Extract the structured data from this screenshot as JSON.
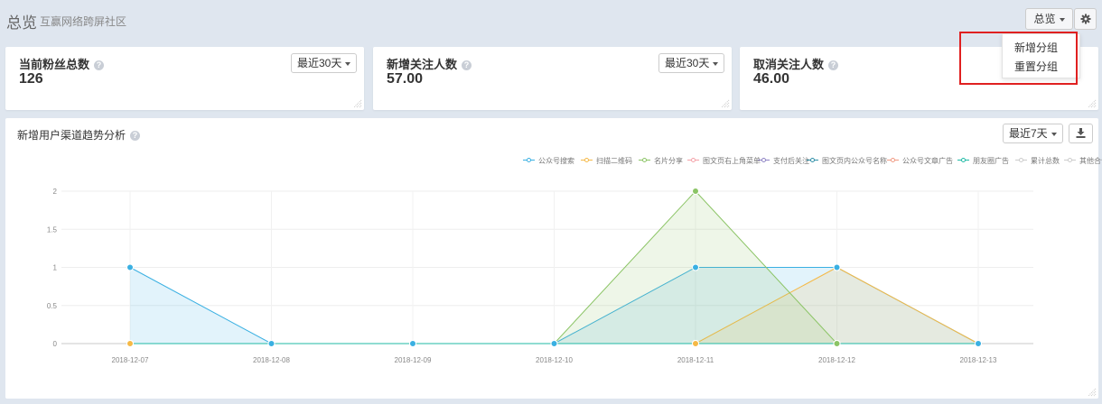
{
  "header": {
    "title": "总览",
    "subtitle": "互赢网络跨屏社区",
    "overview_label": "总览",
    "settings_icon": "gear-icon"
  },
  "menu": {
    "items": [
      "新增分组",
      "重置分组"
    ]
  },
  "cards": [
    {
      "label": "当前粉丝总数",
      "value": "126",
      "range": "最近30天"
    },
    {
      "label": "新增关注人数",
      "value": "57.00",
      "range": "最近30天"
    },
    {
      "label": "取消关注人数",
      "value": "46.00",
      "range": ""
    }
  ],
  "chart_panel": {
    "title": "新增用户渠道趋势分析",
    "range": "最近7天",
    "download_icon": "download-icon"
  },
  "chart_data": {
    "type": "area",
    "x": [
      "2018-12-07",
      "2018-12-08",
      "2018-12-09",
      "2018-12-10",
      "2018-12-11",
      "2018-12-12",
      "2018-12-13"
    ],
    "ylim": [
      0,
      2
    ],
    "yticks": [
      "0",
      "0.5",
      "1",
      "1.5",
      "2"
    ],
    "grid": true,
    "legend_position": "top-right",
    "series": [
      {
        "name": "公众号搜索",
        "color": "#3ab0e2",
        "values": [
          1,
          0,
          0,
          0,
          1,
          1,
          0
        ]
      },
      {
        "name": "扫描二维码",
        "color": "#f5b947",
        "values": [
          0,
          0,
          0,
          0,
          0,
          1,
          0
        ]
      },
      {
        "name": "名片分享",
        "color": "#8bc465",
        "values": [
          0,
          0,
          0,
          0,
          2,
          0,
          0
        ]
      },
      {
        "name": "图文页右上角菜单",
        "color": "#f4a1a8",
        "values": [
          0,
          0,
          0,
          0,
          0,
          0,
          0
        ]
      },
      {
        "name": "支付后关注",
        "color": "#8e83c4",
        "values": [
          0,
          0,
          0,
          0,
          0,
          0,
          0
        ]
      },
      {
        "name": "图文页内公众号名称",
        "color": "#2f8fa8",
        "values": [
          0,
          0,
          0,
          0,
          0,
          0,
          0
        ]
      },
      {
        "name": "公众号文章广告",
        "color": "#f09a82",
        "values": [
          0,
          0,
          0,
          0,
          0,
          0,
          0
        ]
      },
      {
        "name": "朋友圈广告",
        "color": "#1fbaa5",
        "values": [
          0,
          0,
          0,
          0,
          0,
          0,
          0
        ]
      },
      {
        "name": "累计总数",
        "color": "#cccccc",
        "values": []
      },
      {
        "name": "其他合计",
        "color": "#cccccc",
        "values": []
      }
    ]
  }
}
